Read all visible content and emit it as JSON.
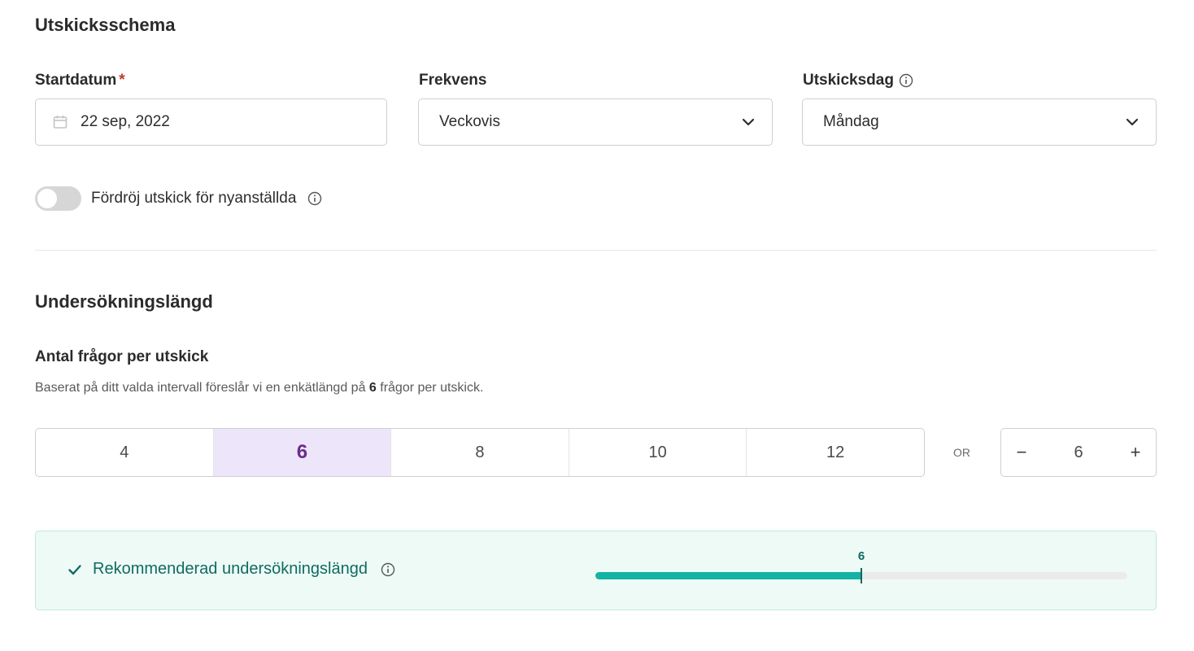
{
  "schedule": {
    "title": "Utskicksschema",
    "start_date": {
      "label": "Startdatum",
      "required_mark": "*",
      "value": "22 sep, 2022"
    },
    "frequency": {
      "label": "Frekvens",
      "value": "Veckovis"
    },
    "send_day": {
      "label": "Utskicksdag",
      "value": "Måndag"
    },
    "delay_toggle": {
      "label": "Fördröj utskick för nyanställda",
      "on": false
    }
  },
  "length": {
    "title": "Undersökningslängd",
    "questions_label": "Antal frågor per utskick",
    "hint_before": "Baserat på ditt valda intervall föreslår vi en enkätlängd på ",
    "hint_value": "6",
    "hint_after": " frågor per utskick.",
    "options": [
      "4",
      "6",
      "8",
      "10",
      "12"
    ],
    "selected": "6",
    "or_label": "OR",
    "stepper": {
      "minus": "−",
      "value": "6",
      "plus": "+"
    }
  },
  "recommendation": {
    "label": "Rekommenderad undersökningslängd",
    "marker_label": "6",
    "fill_fraction": 0.5
  },
  "colors": {
    "accent_teal": "#14b3a3",
    "selected_bg": "#ede6fb",
    "selected_text": "#6b2d8a",
    "required": "#c0392b"
  },
  "icons": [
    "calendar-icon",
    "chevron-down-icon",
    "info-icon",
    "check-icon",
    "minus-icon",
    "plus-icon"
  ]
}
